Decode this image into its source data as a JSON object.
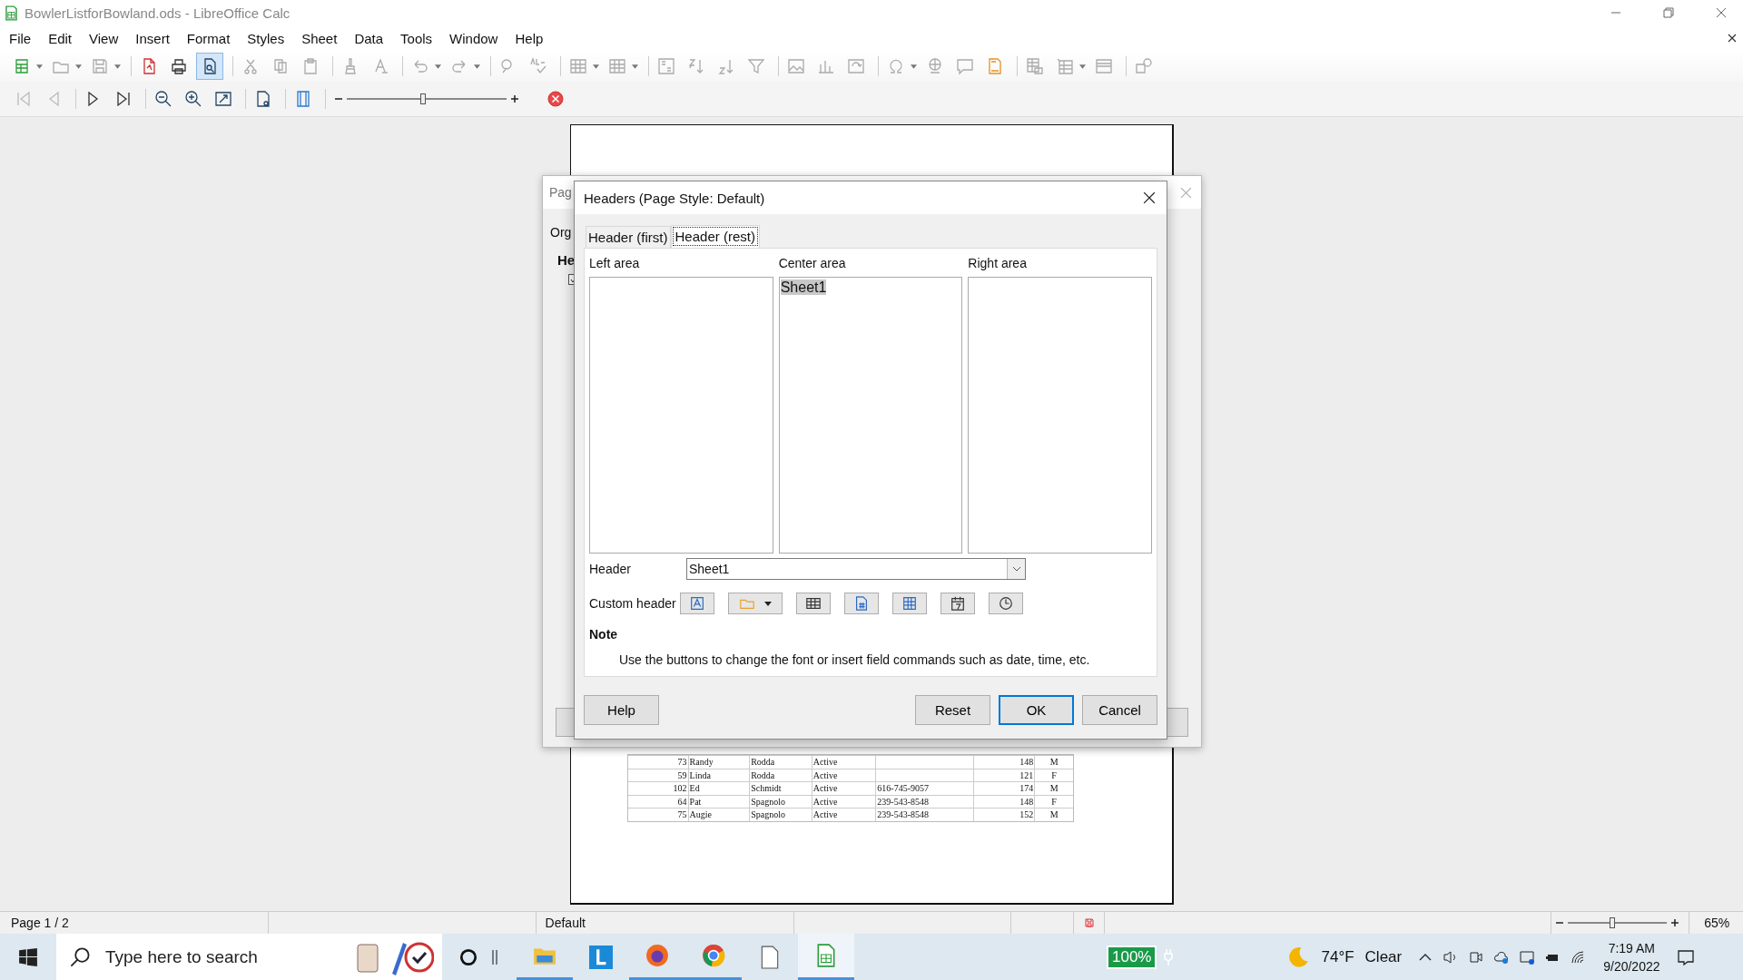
{
  "window": {
    "title": "BowlerListforBowland.ods - LibreOffice Calc"
  },
  "menu": [
    "File",
    "Edit",
    "View",
    "Insert",
    "Format",
    "Styles",
    "Sheet",
    "Data",
    "Tools",
    "Window",
    "Help"
  ],
  "preview_zoom_slider": {
    "level": 0.48
  },
  "page_rows": [
    {
      "id": "73",
      "first": "Randy",
      "last": "Rodda",
      "status": "Active",
      "phone": "",
      "score": "148",
      "sex": "M"
    },
    {
      "id": "59",
      "first": "Linda",
      "last": "Rodda",
      "status": "Active",
      "phone": "",
      "score": "121",
      "sex": "F"
    },
    {
      "id": "102",
      "first": "Ed",
      "last": "Schmidt",
      "status": "Active",
      "phone": "616-745-9057",
      "score": "174",
      "sex": "M"
    },
    {
      "id": "64",
      "first": "Pat",
      "last": "Spagnolo",
      "status": "Active",
      "phone": "239-543-8548",
      "score": "148",
      "sex": "F"
    },
    {
      "id": "75",
      "first": "Augie",
      "last": "Spagnolo",
      "status": "Active",
      "phone": "239-543-8548",
      "score": "152",
      "sex": "M"
    }
  ],
  "back_dialog": {
    "title": "Pag",
    "tab": "Org",
    "section": "He",
    "checked": true
  },
  "dialog": {
    "title": "Headers (Page Style: Default)",
    "tabs": [
      {
        "label": "Header (first)",
        "selected": false
      },
      {
        "label": "Header (rest)",
        "selected": true
      }
    ],
    "areas": [
      {
        "label": "Left area"
      },
      {
        "label": "Center area",
        "text": "Sheet1"
      },
      {
        "label": "Right area"
      }
    ],
    "header_field": {
      "label": "Header",
      "value": "Sheet1"
    },
    "custom_header_label": "Custom header",
    "note_title": "Note",
    "note": "Use the buttons to change the font or insert field commands such as date, time, etc.",
    "buttons": [
      {
        "label": "Help",
        "kind": "help",
        "default": false
      },
      {
        "label": "Reset",
        "kind": "action",
        "default": false
      },
      {
        "label": "OK",
        "kind": "action",
        "default": true
      },
      {
        "label": "Cancel",
        "kind": "action",
        "default": false
      }
    ]
  },
  "status_bar": {
    "page": "Page 1 / 2",
    "style": "Default",
    "zoom_slider": {
      "level": 0.45
    },
    "zoom": "65%"
  },
  "taskbar": {
    "search_placeholder": "Type here to search",
    "battery": "100%",
    "temperature": "74°F",
    "weather": "Clear",
    "time": "7:19 AM",
    "date": "9/20/2022"
  }
}
